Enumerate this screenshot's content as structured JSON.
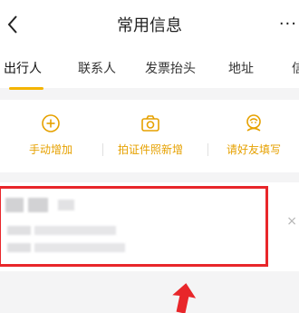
{
  "header": {
    "title": "常用信息",
    "back_icon": "chevron-left-icon",
    "more_icon": "more-horizontal-icon",
    "more_label": "···"
  },
  "tabs": [
    {
      "label": "出行人",
      "active": true
    },
    {
      "label": "联系人",
      "active": false
    },
    {
      "label": "发票抬头",
      "active": false
    },
    {
      "label": "地址",
      "active": false
    },
    {
      "label": "信",
      "active": false
    }
  ],
  "actions": [
    {
      "label": "手动增加",
      "icon": "plus-circle-icon"
    },
    {
      "label": "拍证件照新增",
      "icon": "camera-icon"
    },
    {
      "label": "请好友填写",
      "icon": "friend-icon"
    }
  ],
  "card": {
    "close_label": "×",
    "content_blurred": true
  },
  "colors": {
    "accent": "#f4b400",
    "action_text": "#e6a100",
    "highlight_border": "#e8262a",
    "background": "#f4f4f5"
  }
}
